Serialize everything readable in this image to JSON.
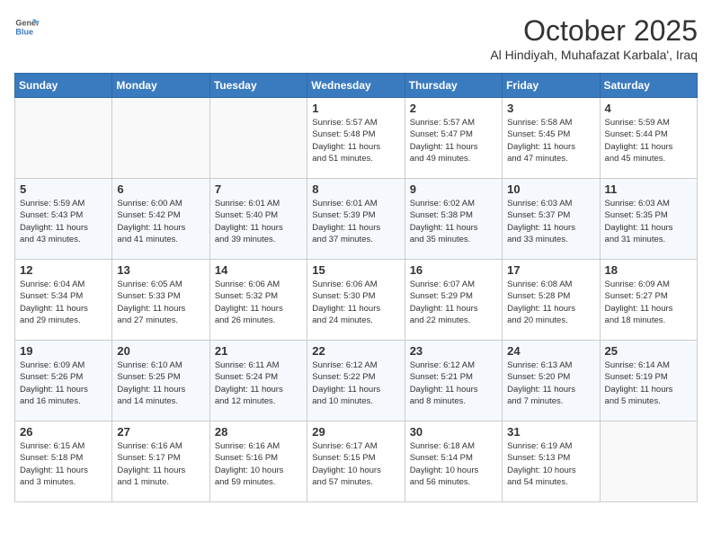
{
  "logo": {
    "line1": "General",
    "line2": "Blue"
  },
  "title": "October 2025",
  "subtitle": "Al Hindiyah, Muhafazat Karbala', Iraq",
  "days_of_week": [
    "Sunday",
    "Monday",
    "Tuesday",
    "Wednesday",
    "Thursday",
    "Friday",
    "Saturday"
  ],
  "weeks": [
    [
      {
        "day": "",
        "info": ""
      },
      {
        "day": "",
        "info": ""
      },
      {
        "day": "",
        "info": ""
      },
      {
        "day": "1",
        "info": "Sunrise: 5:57 AM\nSunset: 5:48 PM\nDaylight: 11 hours\nand 51 minutes."
      },
      {
        "day": "2",
        "info": "Sunrise: 5:57 AM\nSunset: 5:47 PM\nDaylight: 11 hours\nand 49 minutes."
      },
      {
        "day": "3",
        "info": "Sunrise: 5:58 AM\nSunset: 5:45 PM\nDaylight: 11 hours\nand 47 minutes."
      },
      {
        "day": "4",
        "info": "Sunrise: 5:59 AM\nSunset: 5:44 PM\nDaylight: 11 hours\nand 45 minutes."
      }
    ],
    [
      {
        "day": "5",
        "info": "Sunrise: 5:59 AM\nSunset: 5:43 PM\nDaylight: 11 hours\nand 43 minutes."
      },
      {
        "day": "6",
        "info": "Sunrise: 6:00 AM\nSunset: 5:42 PM\nDaylight: 11 hours\nand 41 minutes."
      },
      {
        "day": "7",
        "info": "Sunrise: 6:01 AM\nSunset: 5:40 PM\nDaylight: 11 hours\nand 39 minutes."
      },
      {
        "day": "8",
        "info": "Sunrise: 6:01 AM\nSunset: 5:39 PM\nDaylight: 11 hours\nand 37 minutes."
      },
      {
        "day": "9",
        "info": "Sunrise: 6:02 AM\nSunset: 5:38 PM\nDaylight: 11 hours\nand 35 minutes."
      },
      {
        "day": "10",
        "info": "Sunrise: 6:03 AM\nSunset: 5:37 PM\nDaylight: 11 hours\nand 33 minutes."
      },
      {
        "day": "11",
        "info": "Sunrise: 6:03 AM\nSunset: 5:35 PM\nDaylight: 11 hours\nand 31 minutes."
      }
    ],
    [
      {
        "day": "12",
        "info": "Sunrise: 6:04 AM\nSunset: 5:34 PM\nDaylight: 11 hours\nand 29 minutes."
      },
      {
        "day": "13",
        "info": "Sunrise: 6:05 AM\nSunset: 5:33 PM\nDaylight: 11 hours\nand 27 minutes."
      },
      {
        "day": "14",
        "info": "Sunrise: 6:06 AM\nSunset: 5:32 PM\nDaylight: 11 hours\nand 26 minutes."
      },
      {
        "day": "15",
        "info": "Sunrise: 6:06 AM\nSunset: 5:30 PM\nDaylight: 11 hours\nand 24 minutes."
      },
      {
        "day": "16",
        "info": "Sunrise: 6:07 AM\nSunset: 5:29 PM\nDaylight: 11 hours\nand 22 minutes."
      },
      {
        "day": "17",
        "info": "Sunrise: 6:08 AM\nSunset: 5:28 PM\nDaylight: 11 hours\nand 20 minutes."
      },
      {
        "day": "18",
        "info": "Sunrise: 6:09 AM\nSunset: 5:27 PM\nDaylight: 11 hours\nand 18 minutes."
      }
    ],
    [
      {
        "day": "19",
        "info": "Sunrise: 6:09 AM\nSunset: 5:26 PM\nDaylight: 11 hours\nand 16 minutes."
      },
      {
        "day": "20",
        "info": "Sunrise: 6:10 AM\nSunset: 5:25 PM\nDaylight: 11 hours\nand 14 minutes."
      },
      {
        "day": "21",
        "info": "Sunrise: 6:11 AM\nSunset: 5:24 PM\nDaylight: 11 hours\nand 12 minutes."
      },
      {
        "day": "22",
        "info": "Sunrise: 6:12 AM\nSunset: 5:22 PM\nDaylight: 11 hours\nand 10 minutes."
      },
      {
        "day": "23",
        "info": "Sunrise: 6:12 AM\nSunset: 5:21 PM\nDaylight: 11 hours\nand 8 minutes."
      },
      {
        "day": "24",
        "info": "Sunrise: 6:13 AM\nSunset: 5:20 PM\nDaylight: 11 hours\nand 7 minutes."
      },
      {
        "day": "25",
        "info": "Sunrise: 6:14 AM\nSunset: 5:19 PM\nDaylight: 11 hours\nand 5 minutes."
      }
    ],
    [
      {
        "day": "26",
        "info": "Sunrise: 6:15 AM\nSunset: 5:18 PM\nDaylight: 11 hours\nand 3 minutes."
      },
      {
        "day": "27",
        "info": "Sunrise: 6:16 AM\nSunset: 5:17 PM\nDaylight: 11 hours\nand 1 minute."
      },
      {
        "day": "28",
        "info": "Sunrise: 6:16 AM\nSunset: 5:16 PM\nDaylight: 10 hours\nand 59 minutes."
      },
      {
        "day": "29",
        "info": "Sunrise: 6:17 AM\nSunset: 5:15 PM\nDaylight: 10 hours\nand 57 minutes."
      },
      {
        "day": "30",
        "info": "Sunrise: 6:18 AM\nSunset: 5:14 PM\nDaylight: 10 hours\nand 56 minutes."
      },
      {
        "day": "31",
        "info": "Sunrise: 6:19 AM\nSunset: 5:13 PM\nDaylight: 10 hours\nand 54 minutes."
      },
      {
        "day": "",
        "info": ""
      }
    ]
  ]
}
